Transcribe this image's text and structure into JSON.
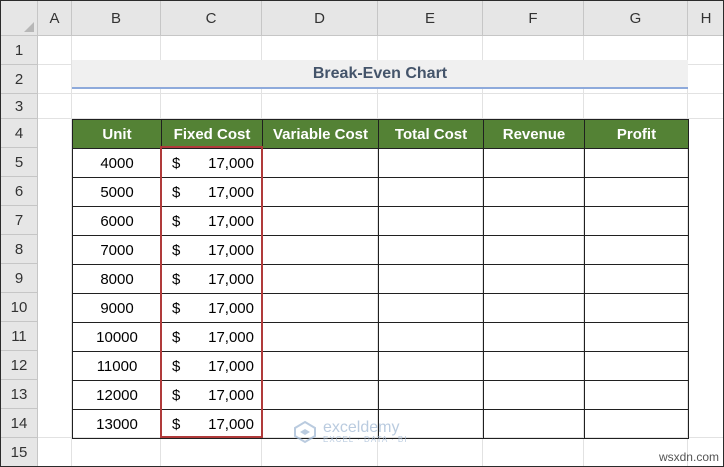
{
  "sheet": {
    "columns": [
      "A",
      "B",
      "C",
      "D",
      "E",
      "F",
      "G",
      "H"
    ],
    "rows": [
      "1",
      "2",
      "3",
      "4",
      "5",
      "6",
      "7",
      "8",
      "9",
      "10",
      "11",
      "12",
      "13",
      "14",
      "15"
    ]
  },
  "title": "Break-Even Chart",
  "table": {
    "headers": [
      "Unit",
      "Fixed Cost",
      "Variable Cost",
      "Total Cost",
      "Revenue",
      "Profit"
    ],
    "currency": "$",
    "rows": [
      {
        "unit": "4000",
        "fixed": "17,000"
      },
      {
        "unit": "5000",
        "fixed": "17,000"
      },
      {
        "unit": "6000",
        "fixed": "17,000"
      },
      {
        "unit": "7000",
        "fixed": "17,000"
      },
      {
        "unit": "8000",
        "fixed": "17,000"
      },
      {
        "unit": "9000",
        "fixed": "17,000"
      },
      {
        "unit": "10000",
        "fixed": "17,000"
      },
      {
        "unit": "11000",
        "fixed": "17,000"
      },
      {
        "unit": "12000",
        "fixed": "17,000"
      },
      {
        "unit": "13000",
        "fixed": "17,000"
      }
    ]
  },
  "watermark": {
    "brand": "exceldemy",
    "tagline": "EXCEL · DATA · BI"
  },
  "site_credit": "wsxdn.com",
  "colors": {
    "header_green": "#548235",
    "highlight_red": "#b03a3a",
    "title_text": "#44546a"
  }
}
